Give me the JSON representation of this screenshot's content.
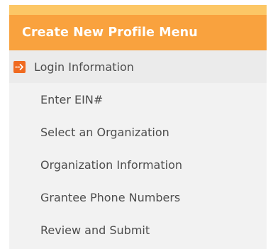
{
  "menu": {
    "title": "Create New Profile Menu",
    "active_icon": "arrow-right-icon",
    "colors": {
      "header": "#f9a23e",
      "top_strip": "#fcc766",
      "active_icon": "#f06a20",
      "item_text": "#4d4d4d",
      "active_background": "#ebebeb"
    },
    "items": [
      {
        "label": "Login Information"
      },
      {
        "label": "Enter EIN#"
      },
      {
        "label": "Select an Organization"
      },
      {
        "label": "Organization Information"
      },
      {
        "label": "Grantee Phone Numbers"
      },
      {
        "label": "Review and Submit"
      }
    ]
  }
}
